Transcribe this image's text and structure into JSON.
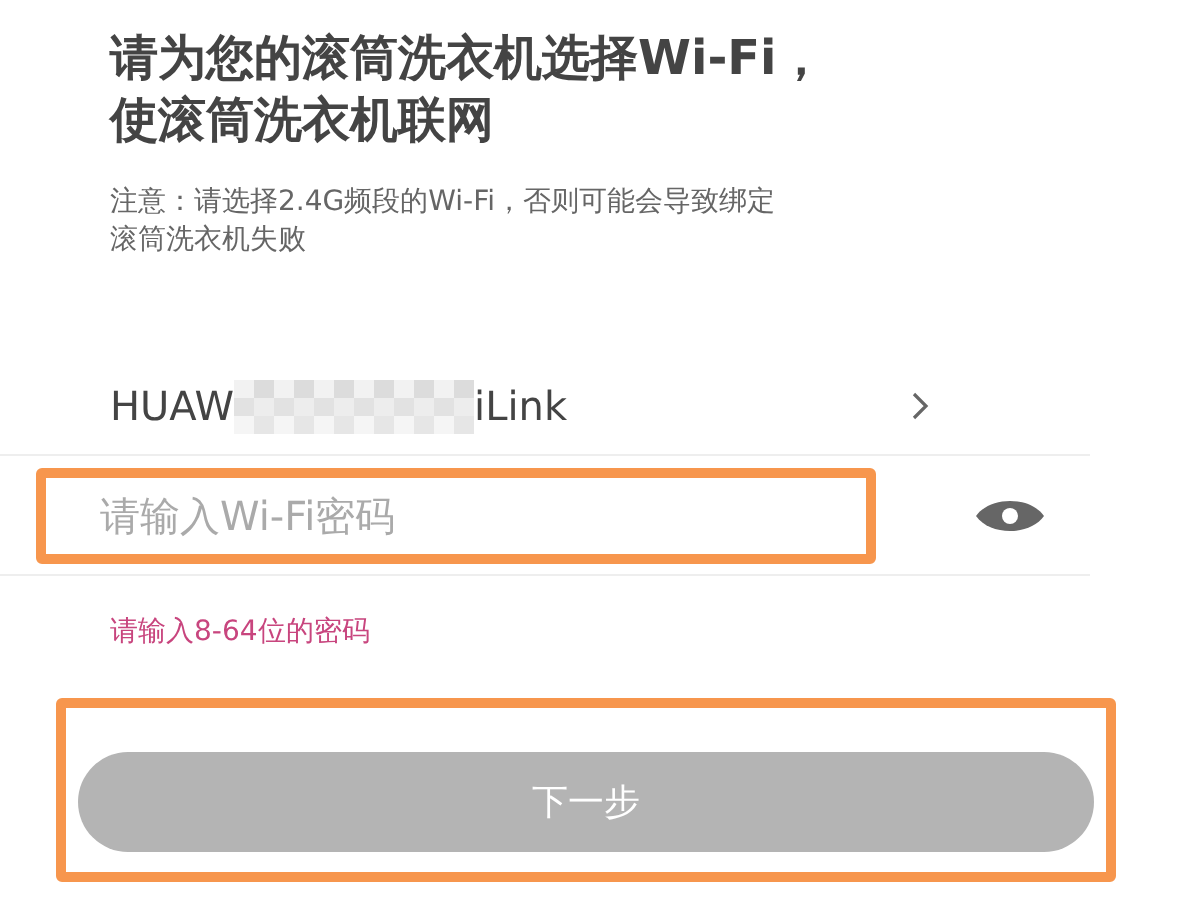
{
  "title": "请为您的滚筒洗衣机选择Wi-Fi，使滚筒洗衣机联网",
  "note": "注意：请选择2.4G频段的Wi-Fi，否则可能会导致绑定滚筒洗衣机失败",
  "network": {
    "name_start": "HUAW",
    "name_end": "iLink"
  },
  "password": {
    "placeholder": "请输入Wi-Fi密码",
    "highlighted": true
  },
  "hint": "请输入8-64位的密码",
  "next_button": {
    "label": "下一步",
    "disabled": true,
    "highlighted": true
  }
}
